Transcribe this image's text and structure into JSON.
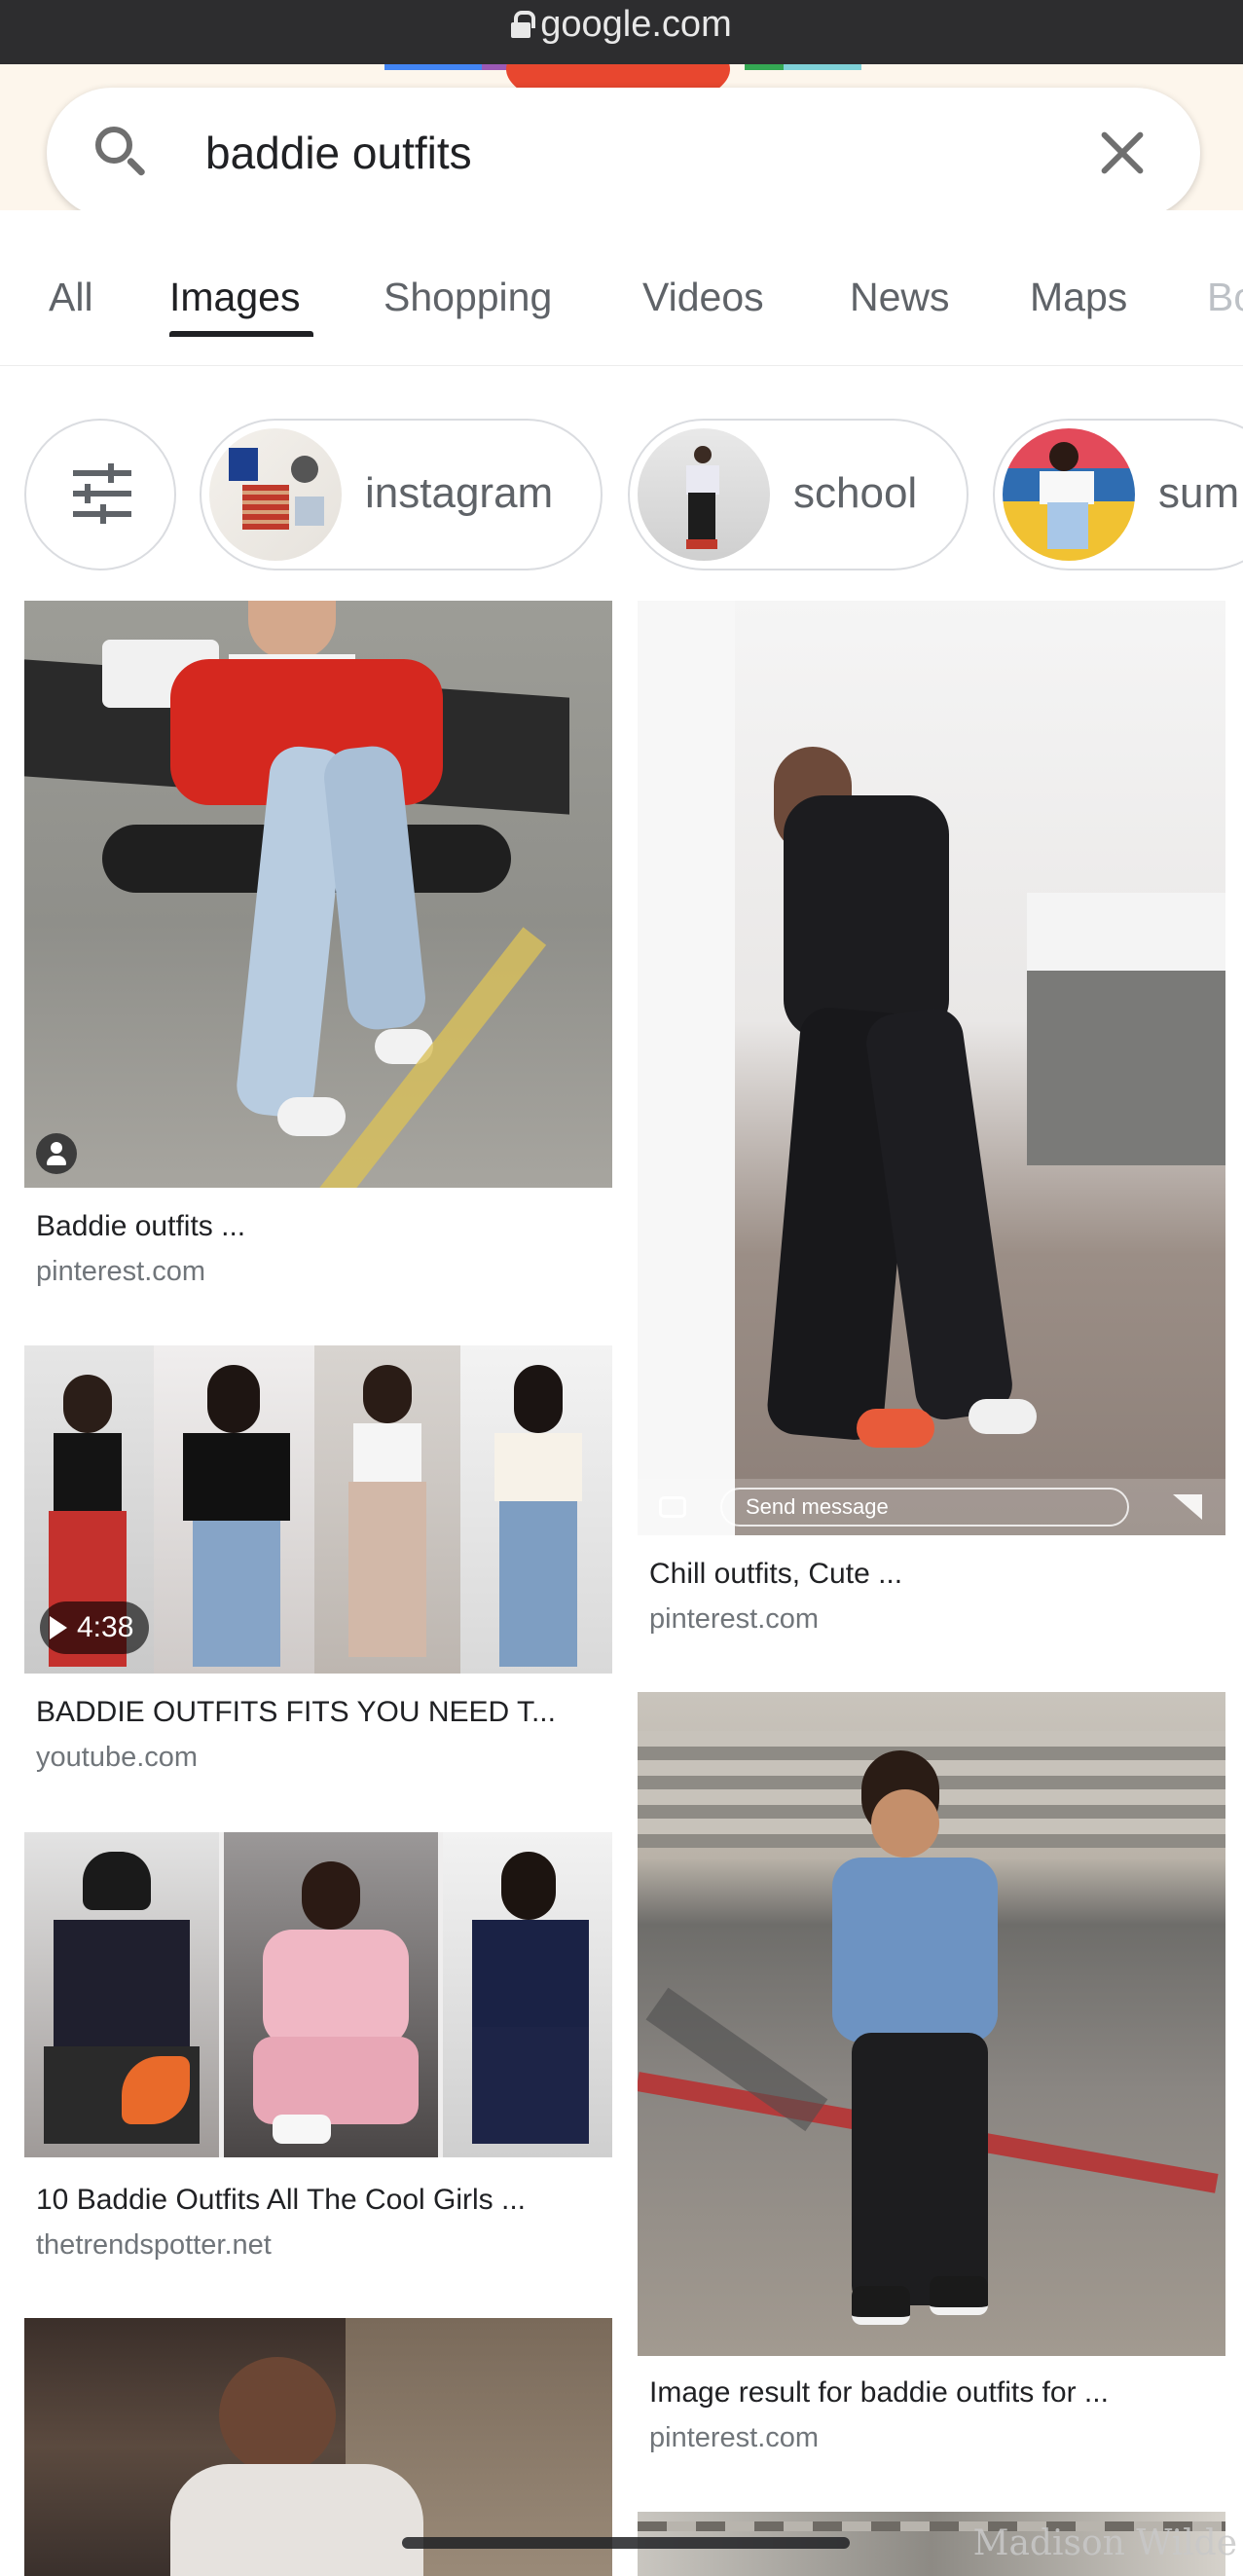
{
  "browser": {
    "url": "google.com"
  },
  "search": {
    "query": "baddie outfits"
  },
  "tabs": [
    {
      "label": "All"
    },
    {
      "label": "Images"
    },
    {
      "label": "Shopping"
    },
    {
      "label": "Videos"
    },
    {
      "label": "News"
    },
    {
      "label": "Maps"
    },
    {
      "label": "Bo"
    }
  ],
  "active_tab": "Images",
  "chips": [
    {
      "label": "instagram"
    },
    {
      "label": "school"
    },
    {
      "label": "sum"
    }
  ],
  "results": [
    {
      "caption": "Baddie outfits ...",
      "domain": "pinterest.com"
    },
    {
      "caption": "Chill outfits, Cute ...",
      "domain": "pinterest.com",
      "overlay_text": "Send message"
    },
    {
      "caption": "BADDIE OUTFITS FITS YOU NEED T...",
      "domain": "youtube.com",
      "duration": "4:38"
    },
    {
      "caption": "Image result for baddie outfits for ...",
      "domain": "pinterest.com"
    },
    {
      "caption": "10 Baddie Outfits All The Cool Girls ...",
      "domain": "thetrendspotter.net"
    }
  ],
  "watermark": "Madison Wilde",
  "colors": {
    "header_bg": "#fdf6ec",
    "url_bar": "#2d2d2f",
    "doodle_red": "#e8472f",
    "secondary_text": "#70757a"
  },
  "icons": [
    "lock-icon",
    "search-icon",
    "close-icon",
    "tune-icon",
    "play-icon",
    "person-icon",
    "camera-icon",
    "send-icon"
  ]
}
